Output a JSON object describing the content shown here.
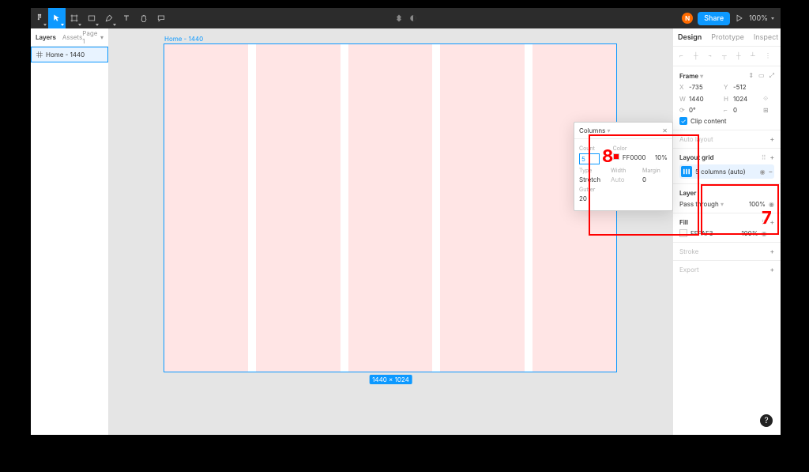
{
  "toolbar": {
    "avatar_initial": "N",
    "share_label": "Share",
    "zoom": "100%"
  },
  "left_panel": {
    "tabs": {
      "layers": "Layers",
      "assets": "Assets"
    },
    "page_label": "Page 1",
    "layer_name": "Home - 1440"
  },
  "canvas": {
    "frame_title": "Home - 1440",
    "dimension_badge": "1440 × 1024"
  },
  "right_panel": {
    "tabs": {
      "design": "Design",
      "prototype": "Prototype",
      "inspect": "Inspect"
    },
    "frame": {
      "title": "Frame",
      "x_label": "X",
      "x": "-735",
      "y_label": "Y",
      "y": "-512",
      "w_label": "W",
      "w": "1440",
      "h_label": "H",
      "h": "1024",
      "rot_label": "0°",
      "corner": "0",
      "clip_label": "Clip content"
    },
    "auto_layout": {
      "title": "Auto layout"
    },
    "layout_grid": {
      "title": "Layout grid",
      "entry": "5 columns (auto)"
    },
    "layer": {
      "title": "Layer",
      "blend": "Pass through",
      "opacity": "100%"
    },
    "fill": {
      "title": "Fill",
      "hex": "FFFAF3",
      "opacity": "100%"
    },
    "stroke": {
      "title": "Stroke"
    },
    "export": {
      "title": "Export"
    }
  },
  "flyout": {
    "title": "Columns",
    "labels": {
      "count": "Count",
      "color": "Color",
      "type": "Type",
      "width": "Width",
      "margin": "Margin",
      "gutter": "Gutter"
    },
    "count": "5",
    "color_hex": "FF0000",
    "color_opacity": "10%",
    "type": "Stretch",
    "width": "Auto",
    "margin": "0",
    "gutter": "20"
  },
  "callouts": {
    "c8": "8",
    "c7": "7"
  }
}
